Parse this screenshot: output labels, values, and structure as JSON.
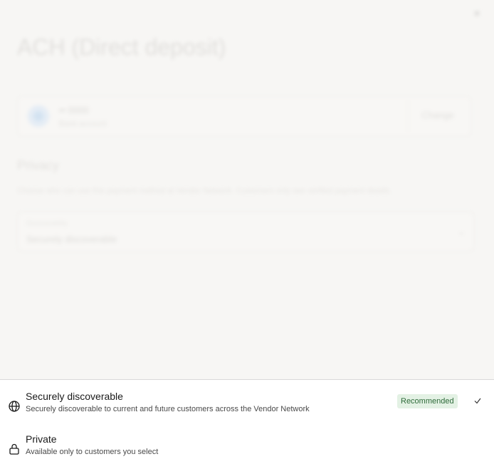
{
  "modal": {
    "close_glyph": "×",
    "title": "ACH (Direct deposit)",
    "account": {
      "name": "•• 0000",
      "subtitle": "Bank account",
      "change_label": "Change"
    },
    "privacy": {
      "heading": "Privacy",
      "description": "Choose who can use this payment method at Vendor Network. Customers only see verified payment details.",
      "select_label": "Discoverability",
      "select_value": "Securely discoverable",
      "chevron_glyph": "⌄"
    }
  },
  "dropdown": {
    "options": [
      {
        "icon": "globe-icon",
        "title": "Securely discoverable",
        "description": "Securely discoverable to current and future customers across the Vendor Network",
        "badge": "Recommended",
        "selected": true
      },
      {
        "icon": "lock-icon",
        "title": "Private",
        "description": "Available only to customers you select",
        "selected": false
      }
    ]
  },
  "colors": {
    "badge_bg": "#e3f1e4",
    "badge_text": "#2f6b3a",
    "sheet_bg": "#ffffff",
    "backdrop_bg": "#f7f6f4"
  }
}
